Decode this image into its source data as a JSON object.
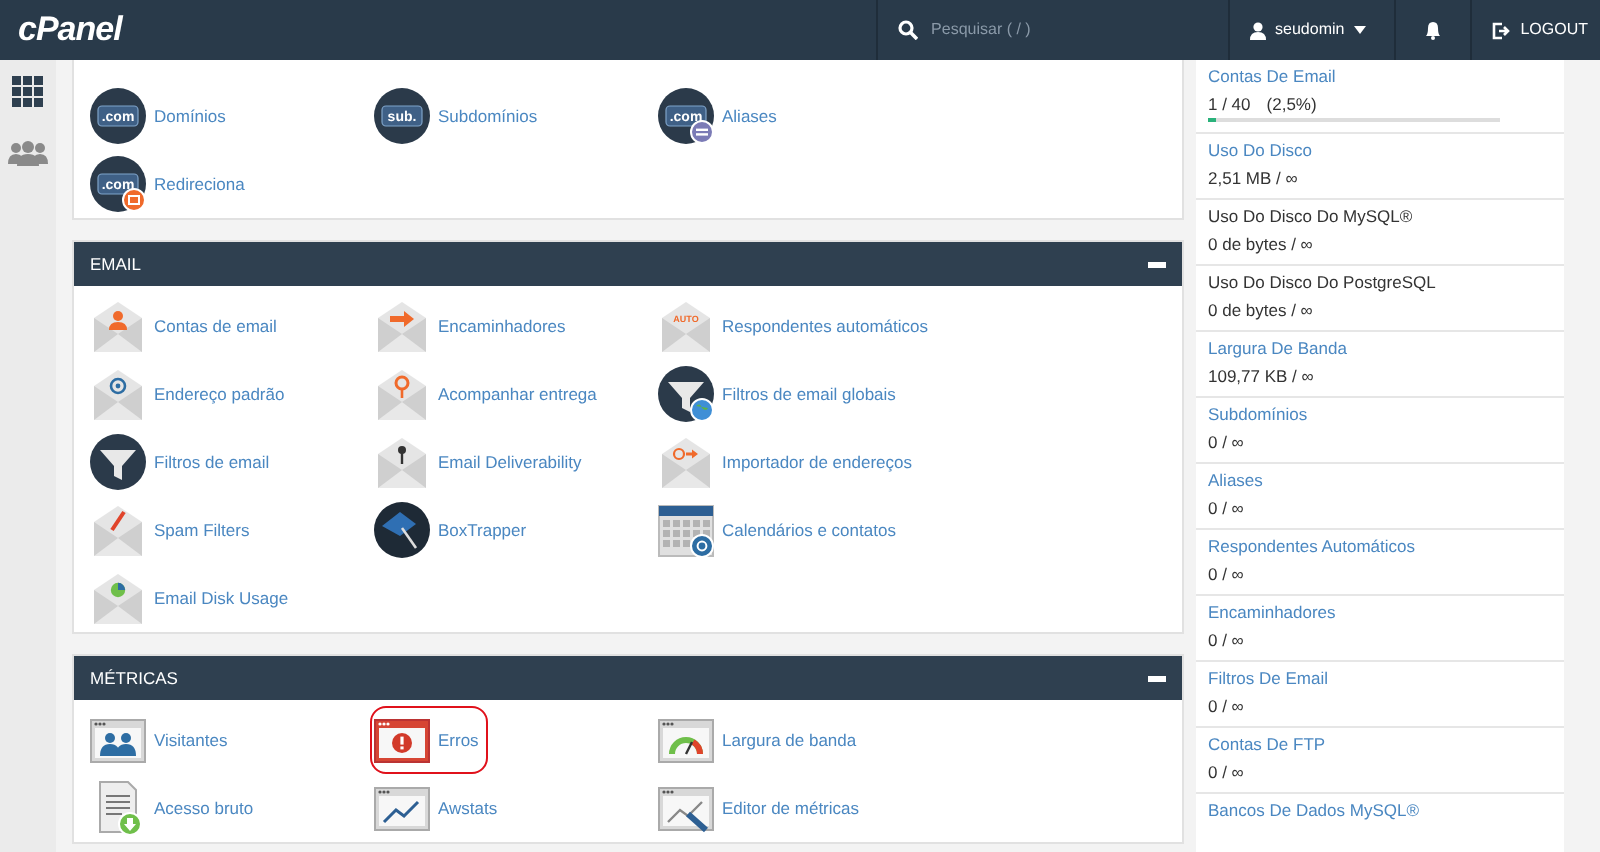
{
  "navbar": {
    "logo": "cPanel",
    "search": {
      "placeholder": "Pesquisar ( / )"
    },
    "user": "seudomin",
    "logout": "LOGOUT"
  },
  "sections": [
    {
      "items": [
        {
          "label": "Domínios",
          "kind": "domain",
          "icon_text": ".com",
          "highlighted": false
        },
        {
          "label": "Subdomínios",
          "kind": "domain",
          "icon_text": "sub.",
          "highlighted": false
        },
        {
          "label": "Aliases",
          "kind": "domain-alias",
          "icon_text": ".com",
          "highlighted": false
        },
        {
          "label": "Redireciona",
          "kind": "domain-redirect",
          "icon_text": ".com",
          "highlighted": false
        }
      ]
    },
    {
      "title": "EMAIL",
      "items": [
        {
          "label": "Contas de email",
          "kind": "envelope-person",
          "highlighted": false
        },
        {
          "label": "Encaminhadores",
          "kind": "envelope-arrow",
          "highlighted": false
        },
        {
          "label": "Respondentes automáticos",
          "kind": "envelope-auto",
          "icon_text": "AUTO",
          "highlighted": false
        },
        {
          "label": "Endereço padrão",
          "kind": "envelope-at",
          "highlighted": false
        },
        {
          "label": "Acompanhar entrega",
          "kind": "envelope-pin",
          "highlighted": false
        },
        {
          "label": "Filtros de email globais",
          "kind": "funnel-globe",
          "highlighted": false
        },
        {
          "label": "Filtros de email",
          "kind": "funnel",
          "highlighted": false
        },
        {
          "label": "Email Deliverability",
          "kind": "envelope-key",
          "highlighted": false
        },
        {
          "label": "Importador de endereços",
          "kind": "envelope-at-arrow",
          "highlighted": false
        },
        {
          "label": "Spam Filters",
          "kind": "envelope-pen",
          "highlighted": false
        },
        {
          "label": "BoxTrapper",
          "kind": "umbrella",
          "highlighted": false
        },
        {
          "label": "Calendários e contatos",
          "kind": "calendar",
          "highlighted": false
        },
        {
          "label": "Email Disk Usage",
          "kind": "envelope-pie",
          "highlighted": false
        }
      ]
    },
    {
      "title": "MÉTRICAS",
      "items": [
        {
          "label": "Visitantes",
          "kind": "window-people",
          "highlighted": false
        },
        {
          "label": "Erros",
          "kind": "window-error",
          "highlighted": true
        },
        {
          "label": "Largura de banda",
          "kind": "window-gauge",
          "highlighted": false
        },
        {
          "label": "Acesso bruto",
          "kind": "document-download",
          "highlighted": false
        },
        {
          "label": "Awstats",
          "kind": "window-chart",
          "highlighted": false
        },
        {
          "label": "Editor de métricas",
          "kind": "window-edit",
          "highlighted": false
        }
      ]
    }
  ],
  "stats": [
    {
      "title": "Contas De Email",
      "value": "1 / 40",
      "percent": "(2,5%)",
      "kind": "link",
      "level": 0.025
    },
    {
      "title": "Uso Do Disco",
      "value": "2,51 MB / ∞",
      "kind": "link"
    },
    {
      "title": "Uso Do Disco Do MySQL®",
      "value": "0 de bytes / ∞",
      "kind": "plain"
    },
    {
      "title": "Uso Do Disco Do PostgreSQL",
      "value": "0 de bytes / ∞",
      "kind": "plain"
    },
    {
      "title": "Largura De Banda",
      "value": "109,77 KB / ∞",
      "kind": "link"
    },
    {
      "title": "Subdomínios",
      "value": "0 / ∞",
      "kind": "link"
    },
    {
      "title": "Aliases",
      "value": "0 / ∞",
      "kind": "link"
    },
    {
      "title": "Respondentes Automáticos",
      "value": "0 / ∞",
      "kind": "link"
    },
    {
      "title": "Encaminhadores",
      "value": "0 / ∞",
      "kind": "link"
    },
    {
      "title": "Filtros De Email",
      "value": "0 / ∞",
      "kind": "link"
    },
    {
      "title": "Contas De FTP",
      "value": "0 / ∞",
      "kind": "link"
    },
    {
      "title": "Bancos De Dados MySQL®",
      "kind": "link"
    }
  ]
}
